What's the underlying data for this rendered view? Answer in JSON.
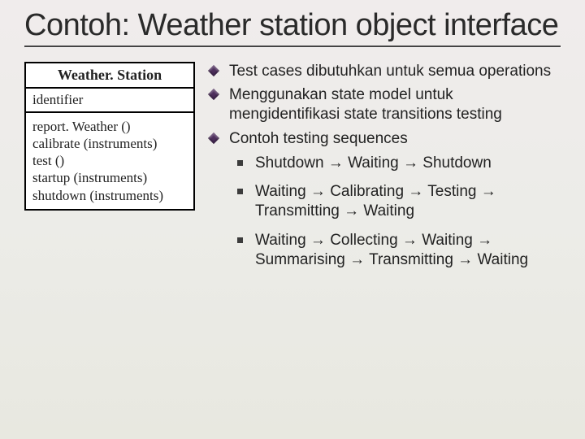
{
  "title": "Contoh: Weather station object interface",
  "uml": {
    "className": "Weather. Station",
    "attribute": "identifier",
    "operations": [
      "report. Weather ()",
      "calibrate (instruments)",
      "test ()",
      "startup (instruments)",
      "shutdown (instruments)"
    ]
  },
  "bullets": [
    "Test cases dibutuhkan untuk semua operations",
    "Menggunakan state model untuk mengidentifikasi state transitions testing",
    "Contoh testing sequences"
  ],
  "sequences": [
    "Shutdown → Waiting → Shutdown",
    "Waiting → Calibrating → Testing → Transmitting → Waiting",
    "Waiting → Collecting → Waiting → Summarising → Transmitting → Waiting"
  ]
}
